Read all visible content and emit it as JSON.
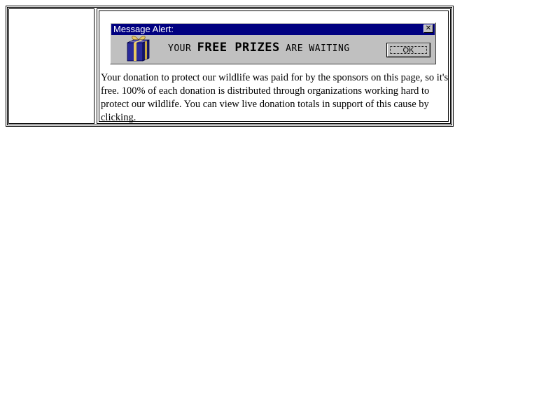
{
  "ad": {
    "title": "Message Alert:",
    "message_prefix": "YOUR",
    "message_highlight": "FREE PRIZES",
    "message_suffix": "ARE WAITING",
    "ok_label": "OK",
    "close_glyph": "✕",
    "icon": "gift-box-icon"
  },
  "content": {
    "body_text": "Your donation to protect our wildlife was paid for by the sponsors on this page, so it's free. 100% of each donation is distributed through organizations working hard to protect our wildlife. You can view live donation totals in support of this cause by clicking."
  },
  "colors": {
    "titlebar": "#000080",
    "face": "#c0c0c0",
    "gift_blue": "#2a2a9a",
    "ribbon": "#e8c860"
  }
}
